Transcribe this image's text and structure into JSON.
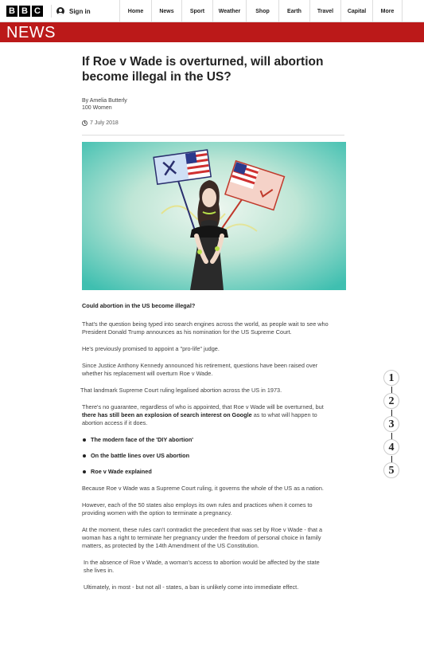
{
  "logo": {
    "letters": [
      "B",
      "B",
      "C"
    ]
  },
  "header": {
    "signin_label": "Sign in",
    "nav": [
      "Home",
      "News",
      "Sport",
      "Weather",
      "Shop",
      "Earth",
      "Travel",
      "Capital",
      "More"
    ]
  },
  "banner": {
    "label": "NEWS",
    "color": "#bb1919"
  },
  "article": {
    "headline": "If Roe v Wade is overturned, will abortion become illegal in the US?",
    "author": "By Amelia Butterly",
    "section": "100 Women",
    "date": "7 July 2018",
    "crosshead": "Could abortion in the US become illegal?",
    "paragraphs": [
      "That's the question being typed into search engines across the world, as people wait to see who President Donald Trump announces as his nomination for the US Supreme Court.",
      "He's previously promised to appoint a \"pro-life\" judge.",
      "Since Justice Anthony Kennedy announced his retirement, questions have been raised over whether his replacement will overturn Roe v Wade.",
      "That landmark Supreme Court ruling legalised abortion across the US in 1973."
    ],
    "para_google_pre": "There's no guarantee, regardless of who is appointed, that Roe v Wade will be overturned, but ",
    "para_google_bold": "there has still been an explosion of search interest on Google",
    "para_google_post": " as to what will happen to abortion access if it does.",
    "links": [
      "The modern face of the 'DIY abortion'",
      "On the battle lines over US abortion",
      "Roe v Wade explained"
    ],
    "paragraphs2": [
      "Because Roe v Wade was a Supreme Court ruling, it governs the whole of the US as a nation.",
      "However, each of the 50 states also employs its own rules and practices when it comes to providing women with the option to terminate a pregnancy.",
      "At the moment, these rules can't contradict the precedent that was set by Roe v Wade - that a woman has a right to terminate her pregnancy under the freedom of personal choice in family matters, as protected by the 14th Amendment of the US Constitution.",
      "In the absence of Roe v Wade, a woman's access to abortion would be affected by the state she lives in.",
      "Ultimately, in most - but not all - states, a ban is unlikely come into immediate effect."
    ]
  },
  "steps": [
    "1",
    "2",
    "3",
    "4",
    "5"
  ]
}
